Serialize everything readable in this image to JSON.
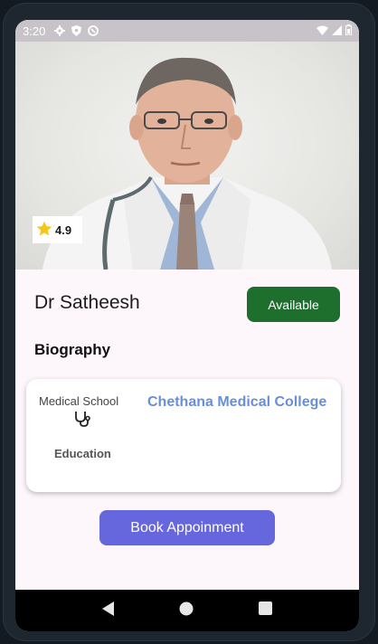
{
  "status_bar": {
    "time": "3:20",
    "icons": [
      "gear-icon",
      "shield-icon",
      "sync-icon"
    ],
    "right_icons": [
      "wifi-icon",
      "signal-icon",
      "battery-icon"
    ]
  },
  "doctor": {
    "name": "Dr Satheesh",
    "rating": "4.9",
    "availability": "Available"
  },
  "biography": {
    "heading": "Biography",
    "medical_school_label": "Medical School",
    "education_label": "Education",
    "college": "Chethana Medical College"
  },
  "actions": {
    "book_label": "Book Appoinment"
  },
  "colors": {
    "available": "#1e6e2e",
    "book": "#6666dd",
    "college": "#6a8fd6",
    "star": "#f5c518"
  }
}
